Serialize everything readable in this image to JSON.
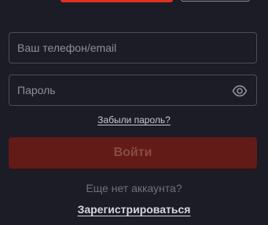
{
  "form": {
    "phone": {
      "placeholder": "Ваш телефон/email",
      "value": ""
    },
    "password": {
      "placeholder": "Пароль",
      "value": "",
      "toggle_icon": "eye-icon"
    },
    "forgot_label": "Забыли пароль?",
    "login_label": "Войти",
    "no_account_text": "Еще нет аккаунта?",
    "register_label": "Зарегистрироваться"
  },
  "colors": {
    "background": "#1b1c26",
    "accent": "#e0301e",
    "button_disabled": "#621b17",
    "border": "#4a4c57"
  }
}
